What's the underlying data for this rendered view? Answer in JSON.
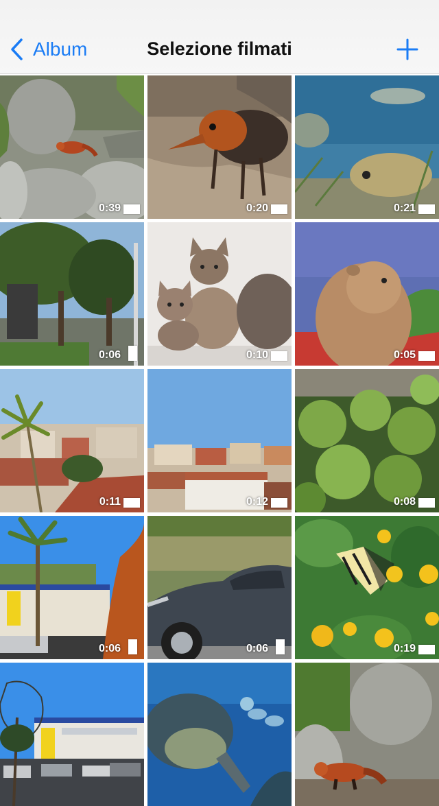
{
  "nav": {
    "back_label": "Album",
    "title": "Selezione filmati"
  },
  "videos": [
    {
      "duration": "0:39",
      "subject": "red panda on rocks",
      "orientation": "landscape"
    },
    {
      "duration": "0:20",
      "subject": "elephant shrew",
      "orientation": "landscape"
    },
    {
      "duration": "0:21",
      "subject": "pufferfish aquarium",
      "orientation": "landscape"
    },
    {
      "duration": "0:06",
      "subject": "street with pine trees",
      "orientation": "portrait"
    },
    {
      "duration": "0:10",
      "subject": "kittens",
      "orientation": "landscape"
    },
    {
      "duration": "0:05",
      "subject": "hamster",
      "orientation": "landscape"
    },
    {
      "duration": "0:11",
      "subject": "rooftops with palm",
      "orientation": "landscape"
    },
    {
      "duration": "0:12",
      "subject": "town rooftops",
      "orientation": "landscape"
    },
    {
      "duration": "0:08",
      "subject": "succulent plants",
      "orientation": "landscape"
    },
    {
      "duration": "0:06",
      "subject": "palm trees street",
      "orientation": "portrait"
    },
    {
      "duration": "0:06",
      "subject": "parked car",
      "orientation": "portrait"
    },
    {
      "duration": "0:19",
      "subject": "butterfly on flowers",
      "orientation": "landscape"
    },
    {
      "duration": "",
      "subject": "building and parking",
      "orientation": "landscape"
    },
    {
      "duration": "",
      "subject": "sea turtle aquarium",
      "orientation": "landscape"
    },
    {
      "duration": "",
      "subject": "red panda walking",
      "orientation": "landscape"
    }
  ],
  "colors": {
    "accent": "#1a7cf5"
  }
}
